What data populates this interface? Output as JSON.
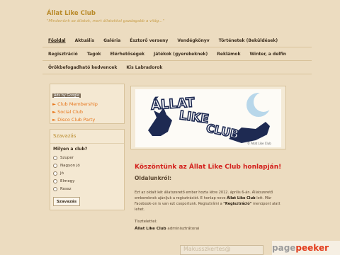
{
  "site": {
    "title": "Állat Like Club",
    "slogan": "\"Mindenünk az állatok, mert állatokkal gazdagabb a világ...\""
  },
  "nav": {
    "row1": [
      "Főoldal",
      "Aktuális",
      "Galéria",
      "Észtorő verseny",
      "Vendégkönyv",
      "Történetek (Beküldések)"
    ],
    "row2": [
      "Regisztráció",
      "Tagok",
      "Elérhetőségek",
      "Játékok (gyerekeknek)",
      "Reklámok",
      "Winter, a delfin"
    ],
    "row3": [
      "Örökbefogadható kedvencek",
      "Kis Labradorok"
    ],
    "active": "Főoldal"
  },
  "ads": {
    "label": "Ads by Google",
    "links": [
      "► Club Membership",
      "► Social Club",
      "► Disco Club Party"
    ]
  },
  "poll": {
    "title": "Szavazás",
    "question": "Milyen a club?",
    "options": [
      "Szuper",
      "Nagyon jó",
      "Jó",
      "Elmegy",
      "Rossz"
    ],
    "submit_label": "Szavazás"
  },
  "logo": {
    "text_line1": "ÁLLAT",
    "text_line2": "LIKE",
    "text_line3": "CLUB",
    "credit": "© Állat Like Club"
  },
  "main": {
    "welcome": "Köszöntünk az Állat Like Club honlapján!",
    "subhead": "Oldalunkról:",
    "para_part1": "Ezt az oldalt két állatszerető ember hozta létre 2012. április 6-án. Állatszerető embereknek ajánljuk a regisztrációt. E honlap neve ",
    "para_bold1": "Állat Like Club",
    "para_part2": " lett. Már Facebook-on is van ezt csoportunk. Regisztrálni a ",
    "para_bold2": "\"Regisztráció\"",
    "para_part3": " menüpont alatt lehet.",
    "sig_greeting": "Tisztelettel:",
    "sig_name": "Állat Like Club",
    "sig_role": " adminisztrátorai"
  },
  "bottom_ad": {
    "text": "Makusszkertes@"
  },
  "watermark": {
    "part1": "page",
    "part2": "peeker"
  },
  "colors": {
    "background": "#ecdcc0",
    "title": "#b98a2a",
    "welcome": "#d3201c",
    "ad_link": "#e7751a"
  }
}
